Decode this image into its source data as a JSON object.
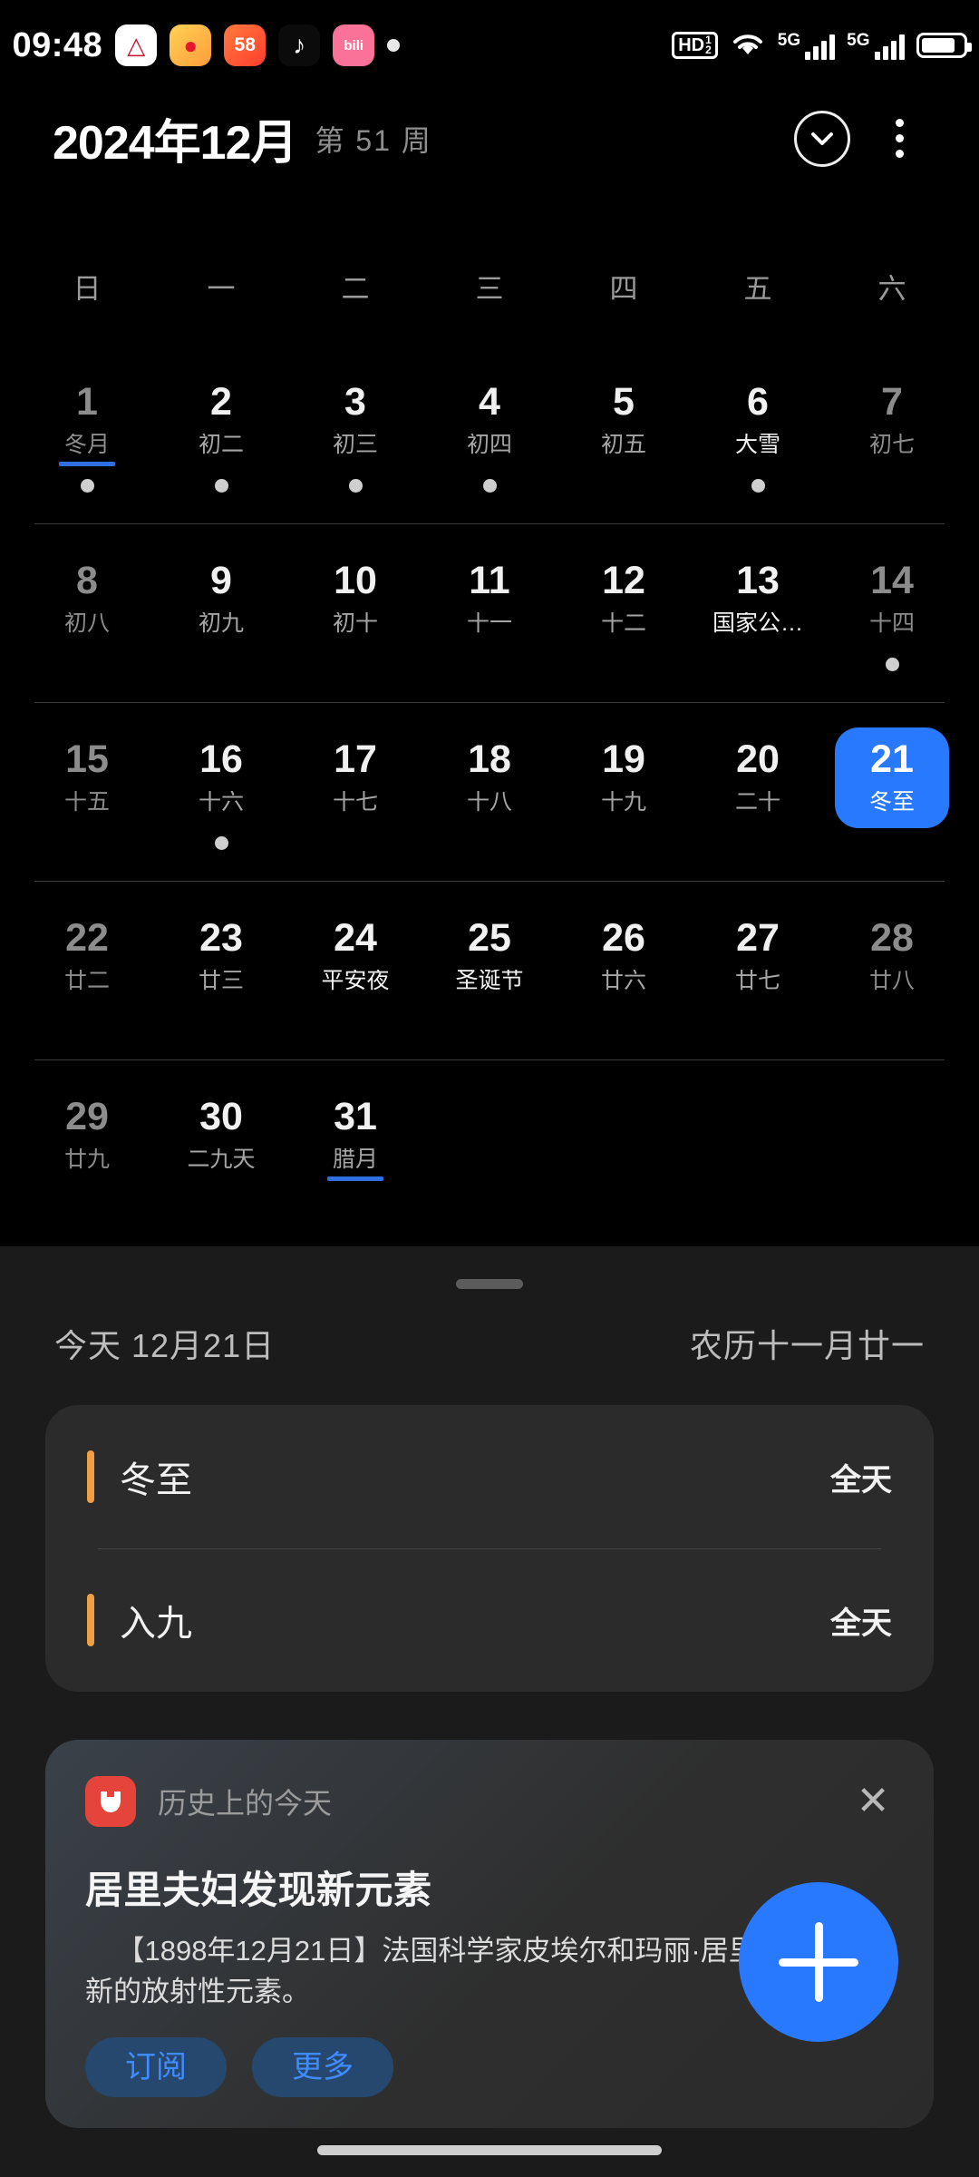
{
  "status_bar": {
    "clock": "09:48",
    "app_icons": [
      {
        "name": "meituan-icon",
        "glyph": "M",
        "bg": "#ffffff",
        "fg": "#c8102e"
      },
      {
        "name": "weibo-icon",
        "glyph": "◎",
        "bg": "#ffcc33",
        "fg": "#e6162d"
      },
      {
        "name": "wuba-icon",
        "glyph": "58",
        "bg": "#ff552e",
        "fg": "#ffffff"
      },
      {
        "name": "tiktok-icon",
        "glyph": "♪",
        "bg": "#000000",
        "fg": "#ffffff"
      },
      {
        "name": "bilibili-icon",
        "glyph": "bili",
        "bg": "#fb7299",
        "fg": "#ffffff"
      }
    ],
    "notification_dot": "•",
    "hd_label": "HD",
    "hd_sup": "1",
    "hd_sub": "2",
    "sim1_label": "5G",
    "sim2_label": "5G",
    "battery_level": "82"
  },
  "header": {
    "title": "2024年12月",
    "week_label": "第 51 周",
    "collapse_icon": "chevron-down-icon",
    "overflow_icon": "more-vertical-icon"
  },
  "weekdays": [
    "日",
    "一",
    "二",
    "三",
    "四",
    "五",
    "六"
  ],
  "weeks": [
    [
      {
        "num": "1",
        "sub": "冬月",
        "dot": true,
        "underline": true,
        "state": "dim"
      },
      {
        "num": "2",
        "sub": "初二",
        "dot": true,
        "underline": false,
        "state": "normal"
      },
      {
        "num": "3",
        "sub": "初三",
        "dot": true,
        "underline": false,
        "state": "normal"
      },
      {
        "num": "4",
        "sub": "初四",
        "dot": true,
        "underline": false,
        "state": "normal"
      },
      {
        "num": "5",
        "sub": "初五",
        "dot": false,
        "underline": false,
        "state": "normal"
      },
      {
        "num": "6",
        "sub": "大雪",
        "dot": true,
        "underline": false,
        "state": "bright"
      },
      {
        "num": "7",
        "sub": "初七",
        "dot": false,
        "underline": false,
        "state": "dim"
      }
    ],
    [
      {
        "num": "8",
        "sub": "初八",
        "dot": false,
        "underline": false,
        "state": "dim"
      },
      {
        "num": "9",
        "sub": "初九",
        "dot": false,
        "underline": false,
        "state": "normal"
      },
      {
        "num": "10",
        "sub": "初十",
        "dot": false,
        "underline": false,
        "state": "normal"
      },
      {
        "num": "11",
        "sub": "十一",
        "dot": false,
        "underline": false,
        "state": "normal"
      },
      {
        "num": "12",
        "sub": "十二",
        "dot": false,
        "underline": false,
        "state": "normal"
      },
      {
        "num": "13",
        "sub": "国家公…",
        "dot": false,
        "underline": false,
        "state": "bright"
      },
      {
        "num": "14",
        "sub": "十四",
        "dot": true,
        "underline": false,
        "state": "dim"
      }
    ],
    [
      {
        "num": "15",
        "sub": "十五",
        "dot": false,
        "underline": false,
        "state": "dim"
      },
      {
        "num": "16",
        "sub": "十六",
        "dot": true,
        "underline": false,
        "state": "normal"
      },
      {
        "num": "17",
        "sub": "十七",
        "dot": false,
        "underline": false,
        "state": "normal"
      },
      {
        "num": "18",
        "sub": "十八",
        "dot": false,
        "underline": false,
        "state": "normal"
      },
      {
        "num": "19",
        "sub": "十九",
        "dot": false,
        "underline": false,
        "state": "normal"
      },
      {
        "num": "20",
        "sub": "二十",
        "dot": false,
        "underline": false,
        "state": "normal"
      },
      {
        "num": "21",
        "sub": "冬至",
        "dot": false,
        "underline": false,
        "state": "today"
      }
    ],
    [
      {
        "num": "22",
        "sub": "廿二",
        "dot": false,
        "underline": false,
        "state": "dim"
      },
      {
        "num": "23",
        "sub": "廿三",
        "dot": false,
        "underline": false,
        "state": "normal"
      },
      {
        "num": "24",
        "sub": "平安夜",
        "dot": false,
        "underline": false,
        "state": "bright"
      },
      {
        "num": "25",
        "sub": "圣诞节",
        "dot": false,
        "underline": false,
        "state": "bright"
      },
      {
        "num": "26",
        "sub": "廿六",
        "dot": false,
        "underline": false,
        "state": "normal"
      },
      {
        "num": "27",
        "sub": "廿七",
        "dot": false,
        "underline": false,
        "state": "normal"
      },
      {
        "num": "28",
        "sub": "廿八",
        "dot": false,
        "underline": false,
        "state": "dim"
      }
    ],
    [
      {
        "num": "29",
        "sub": "廿九",
        "dot": false,
        "underline": false,
        "state": "dim"
      },
      {
        "num": "30",
        "sub": "二九天",
        "dot": false,
        "underline": false,
        "state": "normal"
      },
      {
        "num": "31",
        "sub": "腊月",
        "dot": false,
        "underline": true,
        "state": "normal"
      },
      {
        "num": "",
        "sub": "",
        "dot": false,
        "underline": false,
        "state": "empty"
      },
      {
        "num": "",
        "sub": "",
        "dot": false,
        "underline": false,
        "state": "empty"
      },
      {
        "num": "",
        "sub": "",
        "dot": false,
        "underline": false,
        "state": "empty"
      },
      {
        "num": "",
        "sub": "",
        "dot": false,
        "underline": false,
        "state": "empty"
      }
    ]
  ],
  "sheet": {
    "today_label": "今天  12月21日",
    "lunar_label": "农历十一月廿一",
    "events": [
      {
        "title": "冬至",
        "time": "全天",
        "accent": "#f0a043"
      },
      {
        "title": "入九",
        "time": "全天",
        "accent": "#f0a043"
      }
    ]
  },
  "news": {
    "source": "历史上的今天",
    "app_icon": "ox-head-icon",
    "close_icon": "close-icon",
    "title": "居里夫妇发现新元素",
    "body": "【1898年12月21日】法国科学家皮埃尔和玛丽·居里夫妇发现新的放射性元素。",
    "subscribe_label": "订阅",
    "more_label": "更多"
  },
  "fab": {
    "icon": "plus-icon",
    "color": "#2979ff"
  }
}
